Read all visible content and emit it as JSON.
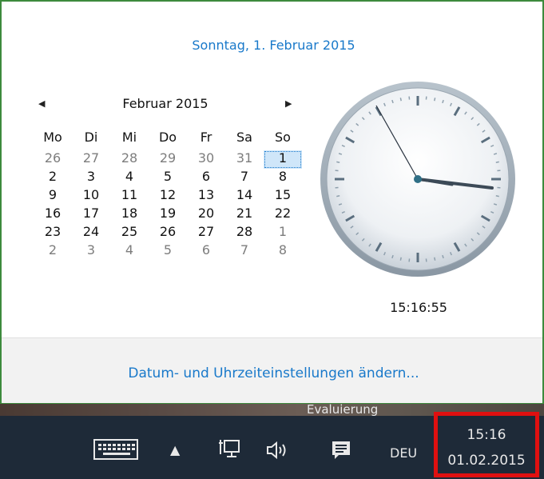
{
  "flyout": {
    "long_date": "Sonntag, 1. Februar 2015",
    "month_title": "Februar 2015",
    "weekdays": [
      "Mo",
      "Di",
      "Mi",
      "Do",
      "Fr",
      "Sa",
      "So"
    ],
    "weeks": [
      [
        {
          "d": "26",
          "other": true
        },
        {
          "d": "27",
          "other": true
        },
        {
          "d": "28",
          "other": true
        },
        {
          "d": "29",
          "other": true
        },
        {
          "d": "30",
          "other": true
        },
        {
          "d": "31",
          "other": true
        },
        {
          "d": "1",
          "today": true
        }
      ],
      [
        {
          "d": "2"
        },
        {
          "d": "3"
        },
        {
          "d": "4"
        },
        {
          "d": "5"
        },
        {
          "d": "6"
        },
        {
          "d": "7"
        },
        {
          "d": "8"
        }
      ],
      [
        {
          "d": "9"
        },
        {
          "d": "10"
        },
        {
          "d": "11"
        },
        {
          "d": "12"
        },
        {
          "d": "13"
        },
        {
          "d": "14"
        },
        {
          "d": "15"
        }
      ],
      [
        {
          "d": "16"
        },
        {
          "d": "17"
        },
        {
          "d": "18"
        },
        {
          "d": "19"
        },
        {
          "d": "20"
        },
        {
          "d": "21"
        },
        {
          "d": "22"
        }
      ],
      [
        {
          "d": "23"
        },
        {
          "d": "24"
        },
        {
          "d": "25"
        },
        {
          "d": "26"
        },
        {
          "d": "27"
        },
        {
          "d": "28"
        },
        {
          "d": "1",
          "other": true
        }
      ],
      [
        {
          "d": "2",
          "other": true
        },
        {
          "d": "3",
          "other": true
        },
        {
          "d": "4",
          "other": true
        },
        {
          "d": "5",
          "other": true
        },
        {
          "d": "6",
          "other": true
        },
        {
          "d": "7",
          "other": true
        },
        {
          "d": "8",
          "other": true
        }
      ]
    ],
    "digital_time": "15:16:55",
    "settings_link": "Datum- und Uhrzeiteinstellungen ändern...",
    "accent_color": "#1979ca"
  },
  "desktop": {
    "eval_text": "Evaluierung"
  },
  "taskbar": {
    "icons": [
      "keyboard-icon",
      "chevron-up-icon",
      "network-icon",
      "volume-icon",
      "action-center-icon"
    ],
    "language": "DEU",
    "tray_time": "15:16",
    "tray_date": "01.02.2015",
    "highlight_color": "#e01010"
  }
}
